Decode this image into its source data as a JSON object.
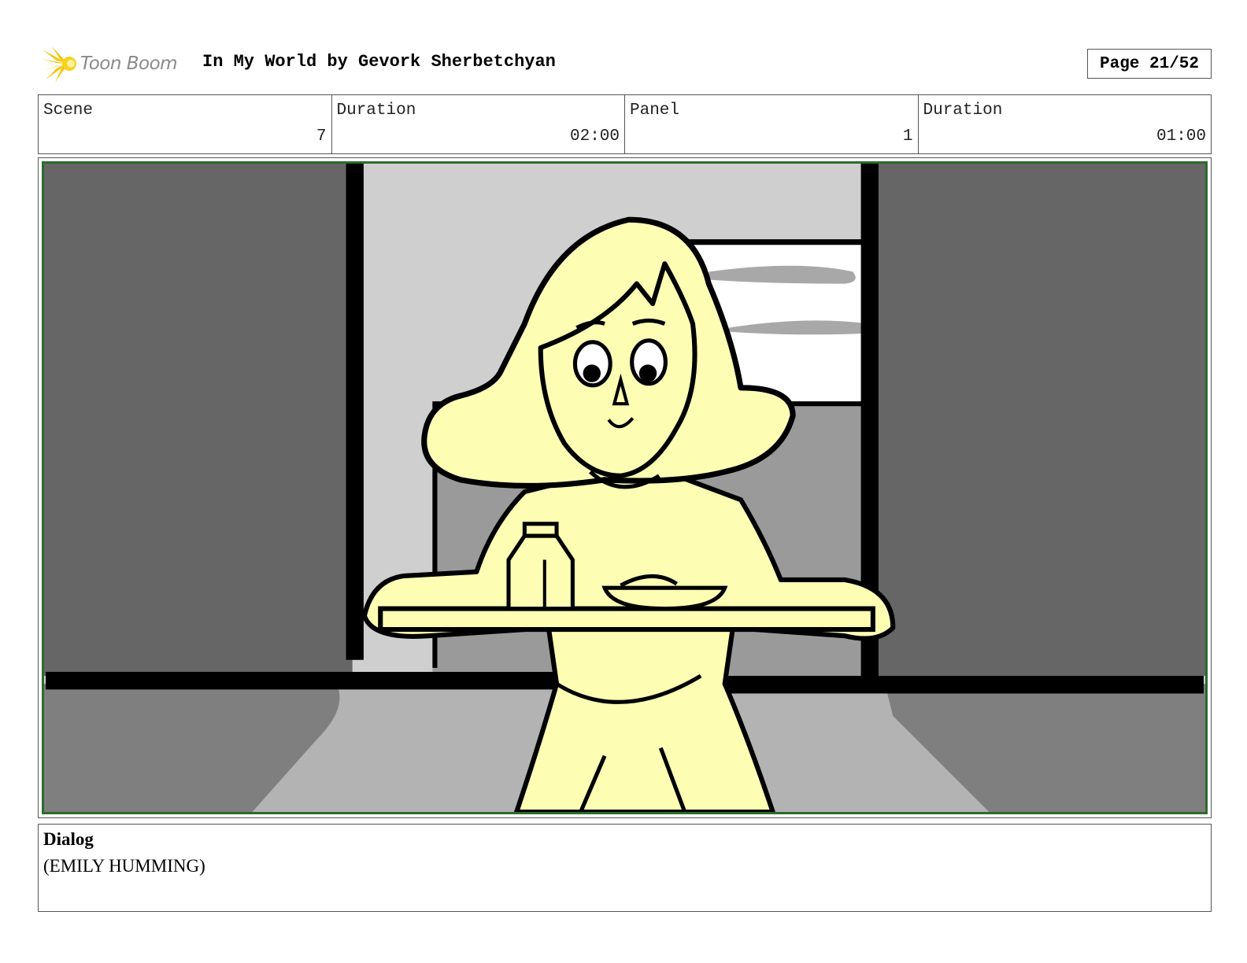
{
  "header": {
    "logo_text": "Toon Boom",
    "title": "In My World by Gevork Sherbetchyan",
    "page": "Page 21/52"
  },
  "info": {
    "scene_label": "Scene",
    "scene_value": "7",
    "scene_duration_label": "Duration",
    "scene_duration_value": "02:00",
    "panel_label": "Panel",
    "panel_value": "1",
    "panel_duration_label": "Duration",
    "panel_duration_value": "01:00"
  },
  "dialog": {
    "label": "Dialog",
    "text": "(EMILY HUMMING)"
  },
  "colors": {
    "skin": "#fdfdb4",
    "wall_dark": "#666666",
    "frame_green": "#2d6b2d"
  }
}
